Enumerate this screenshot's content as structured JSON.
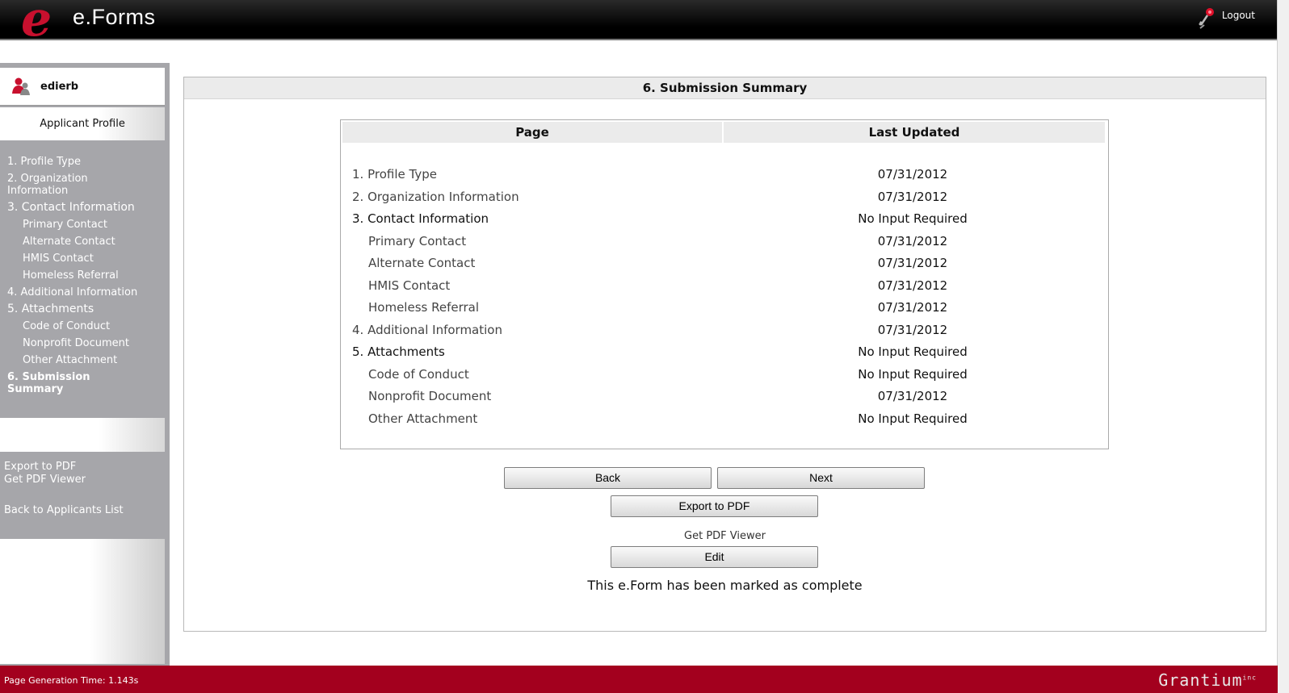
{
  "header": {
    "logo_letter": "e",
    "logo_text": "e.Forms",
    "logout_label": "Logout"
  },
  "sidebar": {
    "username": "edierb",
    "profile_label": "Applicant Profile",
    "nav": [
      {
        "label": "1. Profile Type",
        "level": 0
      },
      {
        "label": "2. Organization Information",
        "level": 0
      },
      {
        "label": "3. Contact Information",
        "level": 0
      },
      {
        "label": "Primary Contact",
        "level": 1
      },
      {
        "label": "Alternate Contact",
        "level": 1
      },
      {
        "label": "HMIS Contact",
        "level": 1
      },
      {
        "label": "Homeless Referral",
        "level": 1
      },
      {
        "label": "4. Additional Information",
        "level": 0
      },
      {
        "label": "5. Attachments",
        "level": 0
      },
      {
        "label": "Code of Conduct",
        "level": 1
      },
      {
        "label": "Nonprofit Document",
        "level": 1
      },
      {
        "label": "Other Attachment",
        "level": 1
      },
      {
        "label": "6. Submission Summary",
        "level": 0
      }
    ],
    "export_pdf": "Export to PDF",
    "get_pdf_viewer": "Get PDF Viewer",
    "back_to_list": "Back to Applicants List"
  },
  "main": {
    "title": "6. Submission Summary",
    "col_page": "Page",
    "col_updated": "Last Updated",
    "rows": [
      {
        "page": "1. Profile Type",
        "updated": "07/31/2012"
      },
      {
        "page": "2. Organization Information",
        "updated": "07/31/2012"
      },
      {
        "page": "3. Contact Information",
        "updated": "No Input Required"
      },
      {
        "page": "Primary Contact",
        "updated": "07/31/2012"
      },
      {
        "page": "Alternate Contact",
        "updated": "07/31/2012"
      },
      {
        "page": "HMIS Contact",
        "updated": "07/31/2012"
      },
      {
        "page": "Homeless Referral",
        "updated": "07/31/2012"
      },
      {
        "page": "4. Additional Information",
        "updated": "07/31/2012"
      },
      {
        "page": "5. Attachments",
        "updated": "No Input Required"
      },
      {
        "page": "Code of Conduct",
        "updated": "No Input Required"
      },
      {
        "page": "Nonprofit Document",
        "updated": "07/31/2012"
      },
      {
        "page": "Other Attachment",
        "updated": "No Input Required"
      }
    ],
    "btn_back": "Back",
    "btn_next": "Next",
    "btn_export": "Export to PDF",
    "get_pdf_viewer": "Get PDF Viewer",
    "btn_edit": "Edit",
    "complete_message": "This e.Form has been marked as complete"
  },
  "footer": {
    "generation_time": "Page Generation Time: 1.143s",
    "brand": "Grantium",
    "brand_suffix": "inc"
  },
  "colors": {
    "brand_red": "#a3001e",
    "logo_red": "#c8102e",
    "sidebar_gray": "#a6a6aa"
  }
}
